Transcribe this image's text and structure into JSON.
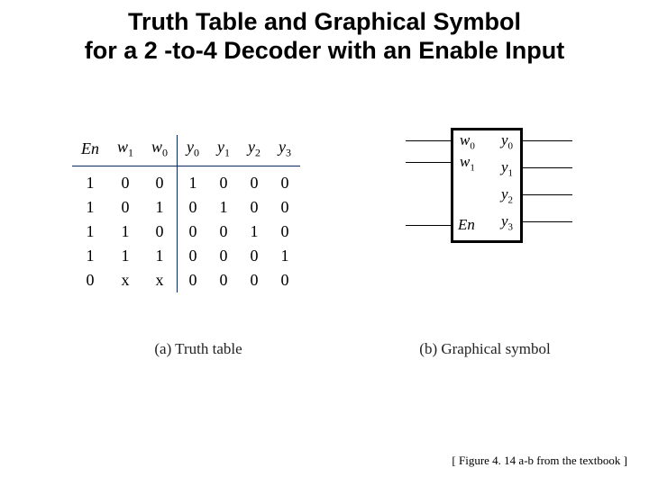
{
  "title_line1": "Truth Table and Graphical Symbol",
  "title_line2": "for a 2 -to-4 Decoder with an Enable Input",
  "truth_table": {
    "headers": [
      "En",
      "w1",
      "w0",
      "y0",
      "y1",
      "y2",
      "y3"
    ],
    "header_display": {
      "En": "En",
      "w1": "w",
      "w1s": "1",
      "w0": "w",
      "w0s": "0",
      "y0": "y",
      "y0s": "0",
      "y1": "y",
      "y1s": "1",
      "y2": "y",
      "y2s": "2",
      "y3": "y",
      "y3s": "3"
    },
    "rows": [
      [
        "1",
        "0",
        "0",
        "1",
        "0",
        "0",
        "0"
      ],
      [
        "1",
        "0",
        "1",
        "0",
        "1",
        "0",
        "0"
      ],
      [
        "1",
        "1",
        "0",
        "0",
        "0",
        "1",
        "0"
      ],
      [
        "1",
        "1",
        "1",
        "0",
        "0",
        "0",
        "1"
      ],
      [
        "0",
        "x",
        "x",
        "0",
        "0",
        "0",
        "0"
      ]
    ],
    "caption": "(a) Truth table"
  },
  "graphical": {
    "inputs": [
      {
        "name": "w",
        "sub": "0"
      },
      {
        "name": "w",
        "sub": "1"
      },
      {
        "name": "En",
        "sub": ""
      }
    ],
    "outputs": [
      {
        "name": "y",
        "sub": "0"
      },
      {
        "name": "y",
        "sub": "1"
      },
      {
        "name": "y",
        "sub": "2"
      },
      {
        "name": "y",
        "sub": "3"
      }
    ],
    "caption": "(b) Graphical symbol"
  },
  "footnote": "[ Figure 4. 14 a-b from the textbook ]"
}
